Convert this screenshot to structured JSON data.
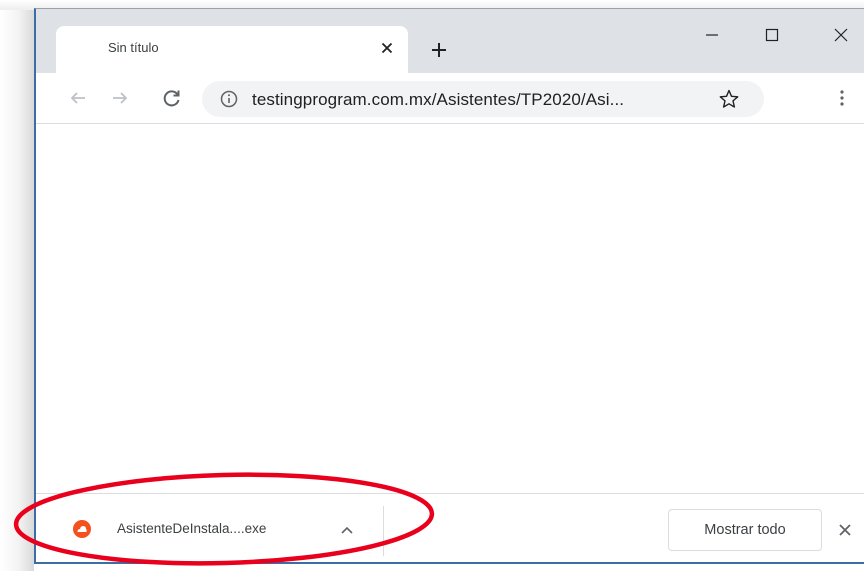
{
  "tab": {
    "title": "Sin título"
  },
  "toolbar": {
    "url": "testingprogram.com.mx/Asistentes/TP2020/Asi..."
  },
  "download": {
    "filename": "AsistenteDeInstala....exe",
    "show_all_label": "Mostrar todo"
  },
  "colors": {
    "tabstrip": "#dee1e6",
    "omnibox": "#f1f3f4",
    "download_icon": "#f4511e",
    "annotation": "#e8001c",
    "window_border": "#3a6ea5"
  },
  "icons": {
    "back": "arrow-left-icon",
    "forward": "arrow-right-icon",
    "reload": "reload-icon",
    "info": "info-icon",
    "bookmark": "star-icon",
    "menu": "kebab-menu-icon",
    "download_file": "file-type-icon",
    "expand": "chevron-up-icon",
    "close": "close-icon"
  }
}
